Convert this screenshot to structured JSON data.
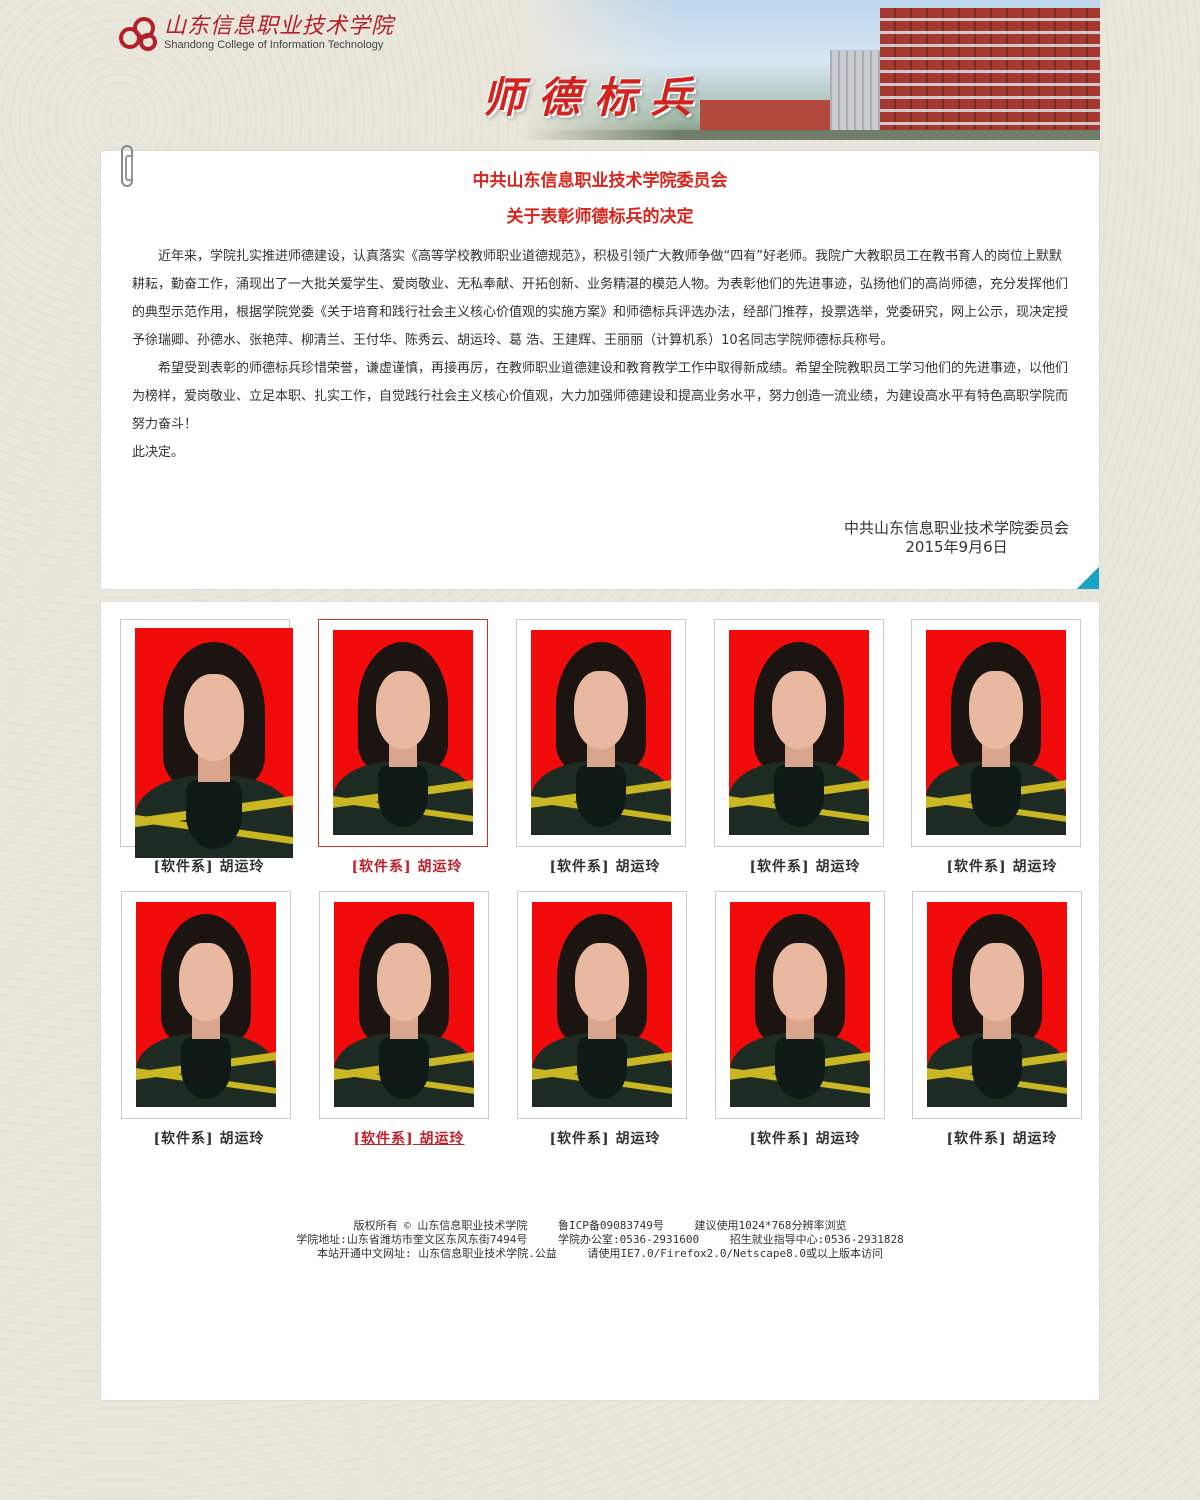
{
  "header": {
    "logo_cn": "山东信息职业技术学院",
    "logo_en": "Shandong College of Information Technology",
    "banner_title": "师德标兵"
  },
  "notice": {
    "title1": "中共山东信息职业技术学院委员会",
    "title2": "关于表彰师德标兵的决定",
    "paragraphs": [
      "近年来，学院扎实推进师德建设，认真落实《高等学校教师职业道德规范》，积极引领广大教师争做“四有”好老师。我院广大教职员工在教书育人的岗位上默默耕耘，勤奋工作，涌现出了一大批关爱学生、爱岗敬业、无私奉献、开拓创新、业务精湛的模范人物。为表彰他们的先进事迹，弘扬他们的高尚师德，充分发挥他们的典型示范作用，根据学院党委《关于培育和践行社会主义核心价值观的实施方案》和师德标兵评选办法，经部门推荐，投票选举，党委研究，网上公示，现决定授予徐瑞卿、孙德水、张艳萍、柳清兰、王付华、陈秀云、胡运玲、葛 浩、王建辉、王丽丽（计算机系）10名同志学院师德标兵称号。",
      "希望受到表彰的师德标兵珍惜荣誉，谦虚谨慎，再接再厉，在教师职业道德建设和教育教学工作中取得新成绩。希望全院教职员工学习他们的先进事迹，以他们为榜样，爱岗敬业、立足本职、扎实工作，自觉践行社会主义核心价值观，大力加强师德建设和提高业务水平，努力创造一流业绩，为建设高水平有特色高职学院而努力奋斗！",
      "此决定。"
    ],
    "sign_org": "中共山东信息职业技术学院委员会",
    "sign_date": "2015年9月6日"
  },
  "gallery": {
    "items": [
      {
        "caption": "[软件系] 胡运玲"
      },
      {
        "caption": "[软件系] 胡运玲"
      },
      {
        "caption": "[软件系] 胡运玲"
      },
      {
        "caption": "[软件系] 胡运玲"
      },
      {
        "caption": "[软件系] 胡运玲"
      },
      {
        "caption": "[软件系] 胡运玲"
      },
      {
        "caption": "[软件系] 胡运玲"
      },
      {
        "caption": "[软件系] 胡运玲"
      },
      {
        "caption": "[软件系] 胡运玲"
      },
      {
        "caption": "[软件系] 胡运玲"
      }
    ]
  },
  "footer": {
    "line1": [
      "版权所有 © 山东信息职业技术学院",
      "鲁ICP备09083749号",
      "建议使用1024*768分辨率浏览"
    ],
    "line2": [
      "学院地址:山东省潍坊市奎文区东风东街7494号",
      "学院办公室:0536-2931600",
      "招生就业指导中心:0536-2931828"
    ],
    "line3": [
      "本站开通中文网址: 山东信息职业技术学院.公益",
      "请使用IE7.0/Firefox2.0/Netscape8.0或以上版本访问"
    ]
  },
  "colors": {
    "accent_red": "#d9261c",
    "photo_bg": "#f20b0b",
    "fold_corner": "#1aa3c2"
  }
}
